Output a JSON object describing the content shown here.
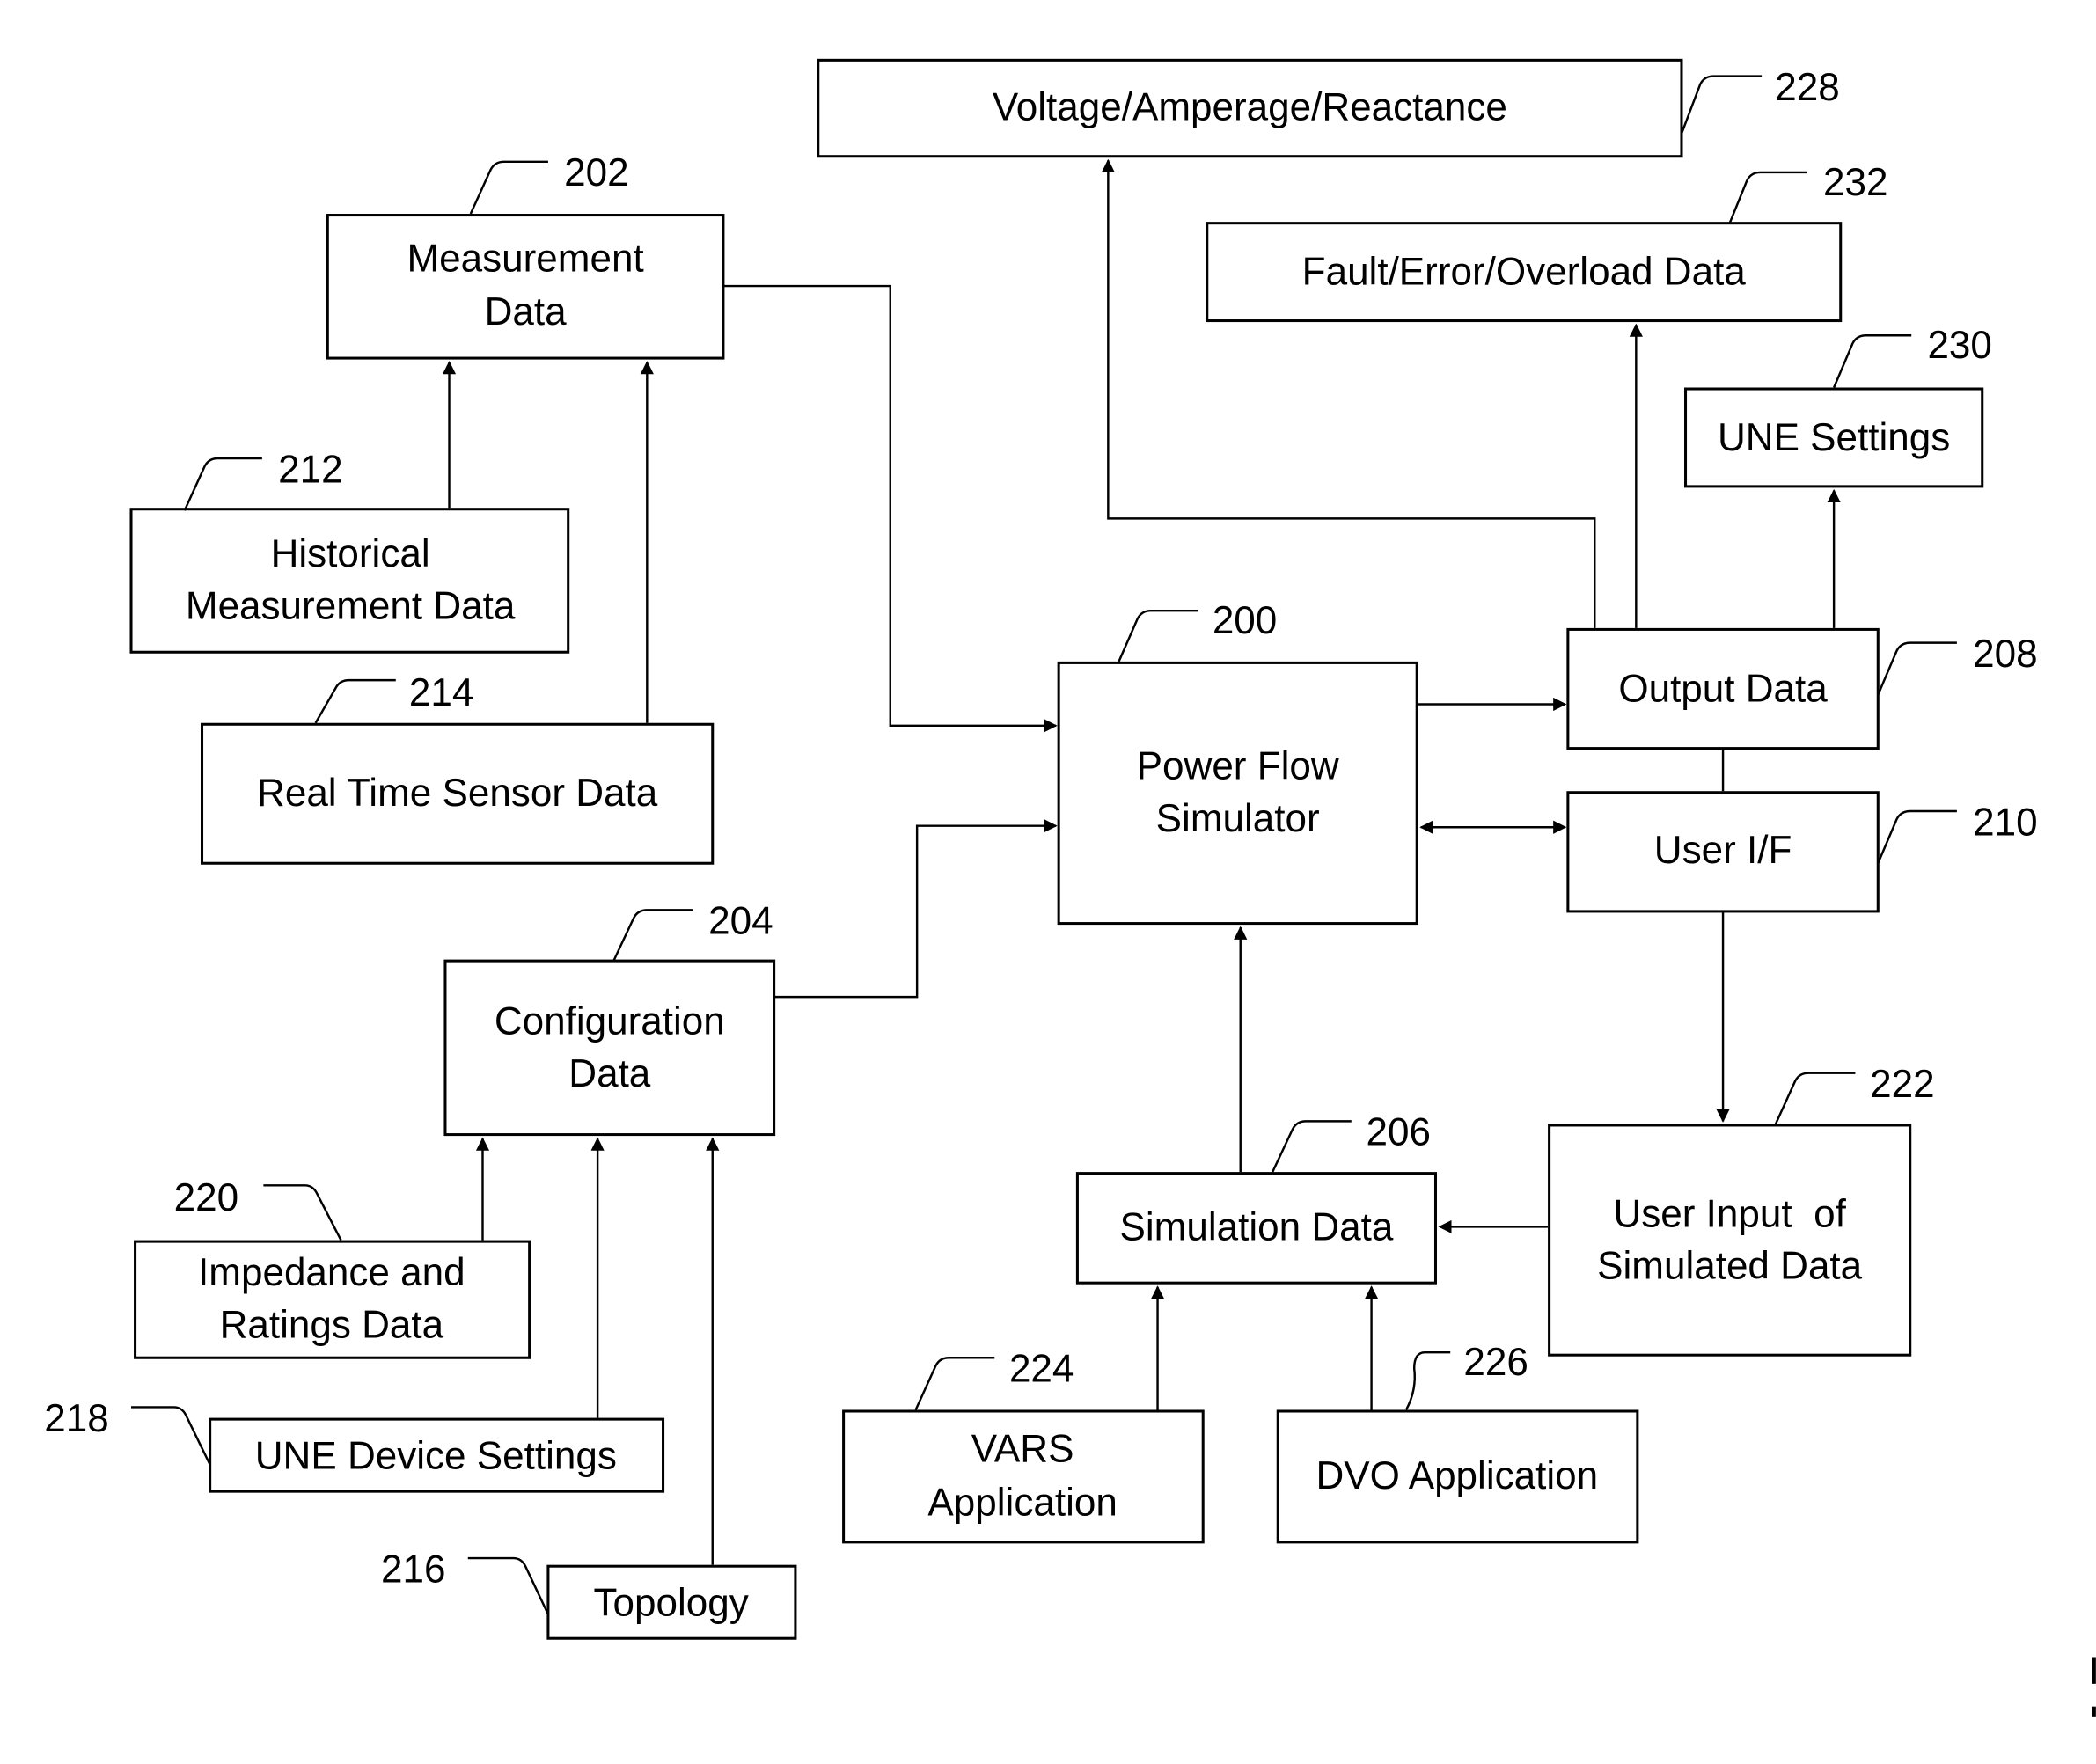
{
  "figure": {
    "nodes": {
      "power_flow_simulator": {
        "ref": "200",
        "lines": [
          "Power Flow",
          "Simulator"
        ]
      },
      "measurement_data": {
        "ref": "202",
        "lines": [
          "Measurement",
          "Data"
        ]
      },
      "configuration_data": {
        "ref": "204",
        "lines": [
          "Configuration",
          "Data"
        ]
      },
      "simulation_data": {
        "ref": "206",
        "lines": [
          "Simulation Data"
        ]
      },
      "output_data": {
        "ref": "208",
        "lines": [
          "Output Data"
        ]
      },
      "user_if": {
        "ref": "210",
        "lines": [
          "User I/F"
        ]
      },
      "historical_measurement_data": {
        "ref": "212",
        "lines": [
          "Historical",
          "Measurement Data"
        ]
      },
      "real_time_sensor_data": {
        "ref": "214",
        "lines": [
          "Real Time Sensor Data"
        ]
      },
      "topology": {
        "ref": "216",
        "lines": [
          "Topology"
        ]
      },
      "une_device_settings": {
        "ref": "218",
        "lines": [
          "UNE Device Settings"
        ]
      },
      "impedance_ratings_data": {
        "ref": "220",
        "lines": [
          "Impedance and",
          "Ratings Data"
        ]
      },
      "user_input_simulated_data": {
        "ref": "222",
        "lines": [
          "User Input  of",
          "Simulated Data"
        ]
      },
      "vars_application": {
        "ref": "224",
        "lines": [
          "VARS",
          "Application"
        ]
      },
      "dvo_application": {
        "ref": "226",
        "lines": [
          "DVO Application"
        ]
      },
      "voltage_amperage_reactance": {
        "ref": "228",
        "lines": [
          "Voltage/Amperage/Reactance"
        ]
      },
      "une_settings": {
        "ref": "230",
        "lines": [
          "UNE Settings"
        ]
      },
      "fault_error_overload_data": {
        "ref": "232",
        "lines": [
          "Fault/Error/Overload Data"
        ]
      }
    },
    "edges": [
      {
        "from": "historical_measurement_data",
        "to": "measurement_data"
      },
      {
        "from": "real_time_sensor_data",
        "to": "measurement_data"
      },
      {
        "from": "measurement_data",
        "to": "power_flow_simulator"
      },
      {
        "from": "configuration_data",
        "to": "power_flow_simulator"
      },
      {
        "from": "impedance_ratings_data",
        "to": "configuration_data"
      },
      {
        "from": "une_device_settings",
        "to": "configuration_data"
      },
      {
        "from": "topology",
        "to": "configuration_data"
      },
      {
        "from": "simulation_data",
        "to": "power_flow_simulator"
      },
      {
        "from": "vars_application",
        "to": "simulation_data"
      },
      {
        "from": "dvo_application",
        "to": "simulation_data"
      },
      {
        "from": "user_input_simulated_data",
        "to": "simulation_data"
      },
      {
        "from": "power_flow_simulator",
        "to": "output_data"
      },
      {
        "from": "power_flow_simulator",
        "to": "user_if",
        "bidirectional": true
      },
      {
        "from": "output_data",
        "to": "user_if",
        "undirected": true
      },
      {
        "from": "user_if",
        "to": "user_input_simulated_data"
      },
      {
        "from": "output_data",
        "to": "voltage_amperage_reactance"
      },
      {
        "from": "output_data",
        "to": "fault_error_overload_data"
      },
      {
        "from": "output_data",
        "to": "une_settings"
      }
    ]
  }
}
